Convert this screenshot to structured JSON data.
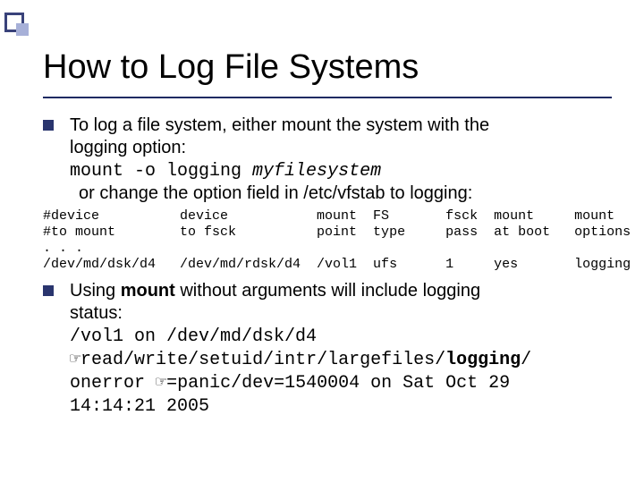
{
  "title": "How to Log File Systems",
  "bullets": {
    "b1": {
      "line1": "To log a file system, either mount the system with the",
      "line2": "logging option:",
      "cmd": "mount -o logging ",
      "cmd_arg": "myfilesystem",
      "line4": "or change the option field in /etc/vfstab to logging:"
    },
    "vfstab": {
      "row1": "#device          device           mount  FS       fsck  mount     mount",
      "row2": "#to mount        to fsck          point  type     pass  at boot   options",
      "row3": ". . .",
      "row4": "/dev/md/dsk/d4   /dev/md/rdsk/d4  /vol1  ufs      1     yes       logging"
    },
    "b2": {
      "line1a": "Using ",
      "line1b": "mount",
      "line1c": " without arguments will include logging",
      "line2": "status:",
      "out1": "/vol1 on /dev/md/dsk/d4",
      "hand1": "☞",
      "out2a": "read/write/setuid/intr/largefiles/",
      "out2b": "logging",
      "out2c": "/",
      "out3a": "onerror ",
      "hand2": "☞",
      "out3b": "=panic/dev=1540004 on Sat Oct 29",
      "out4": "14:14:21 2005"
    }
  }
}
